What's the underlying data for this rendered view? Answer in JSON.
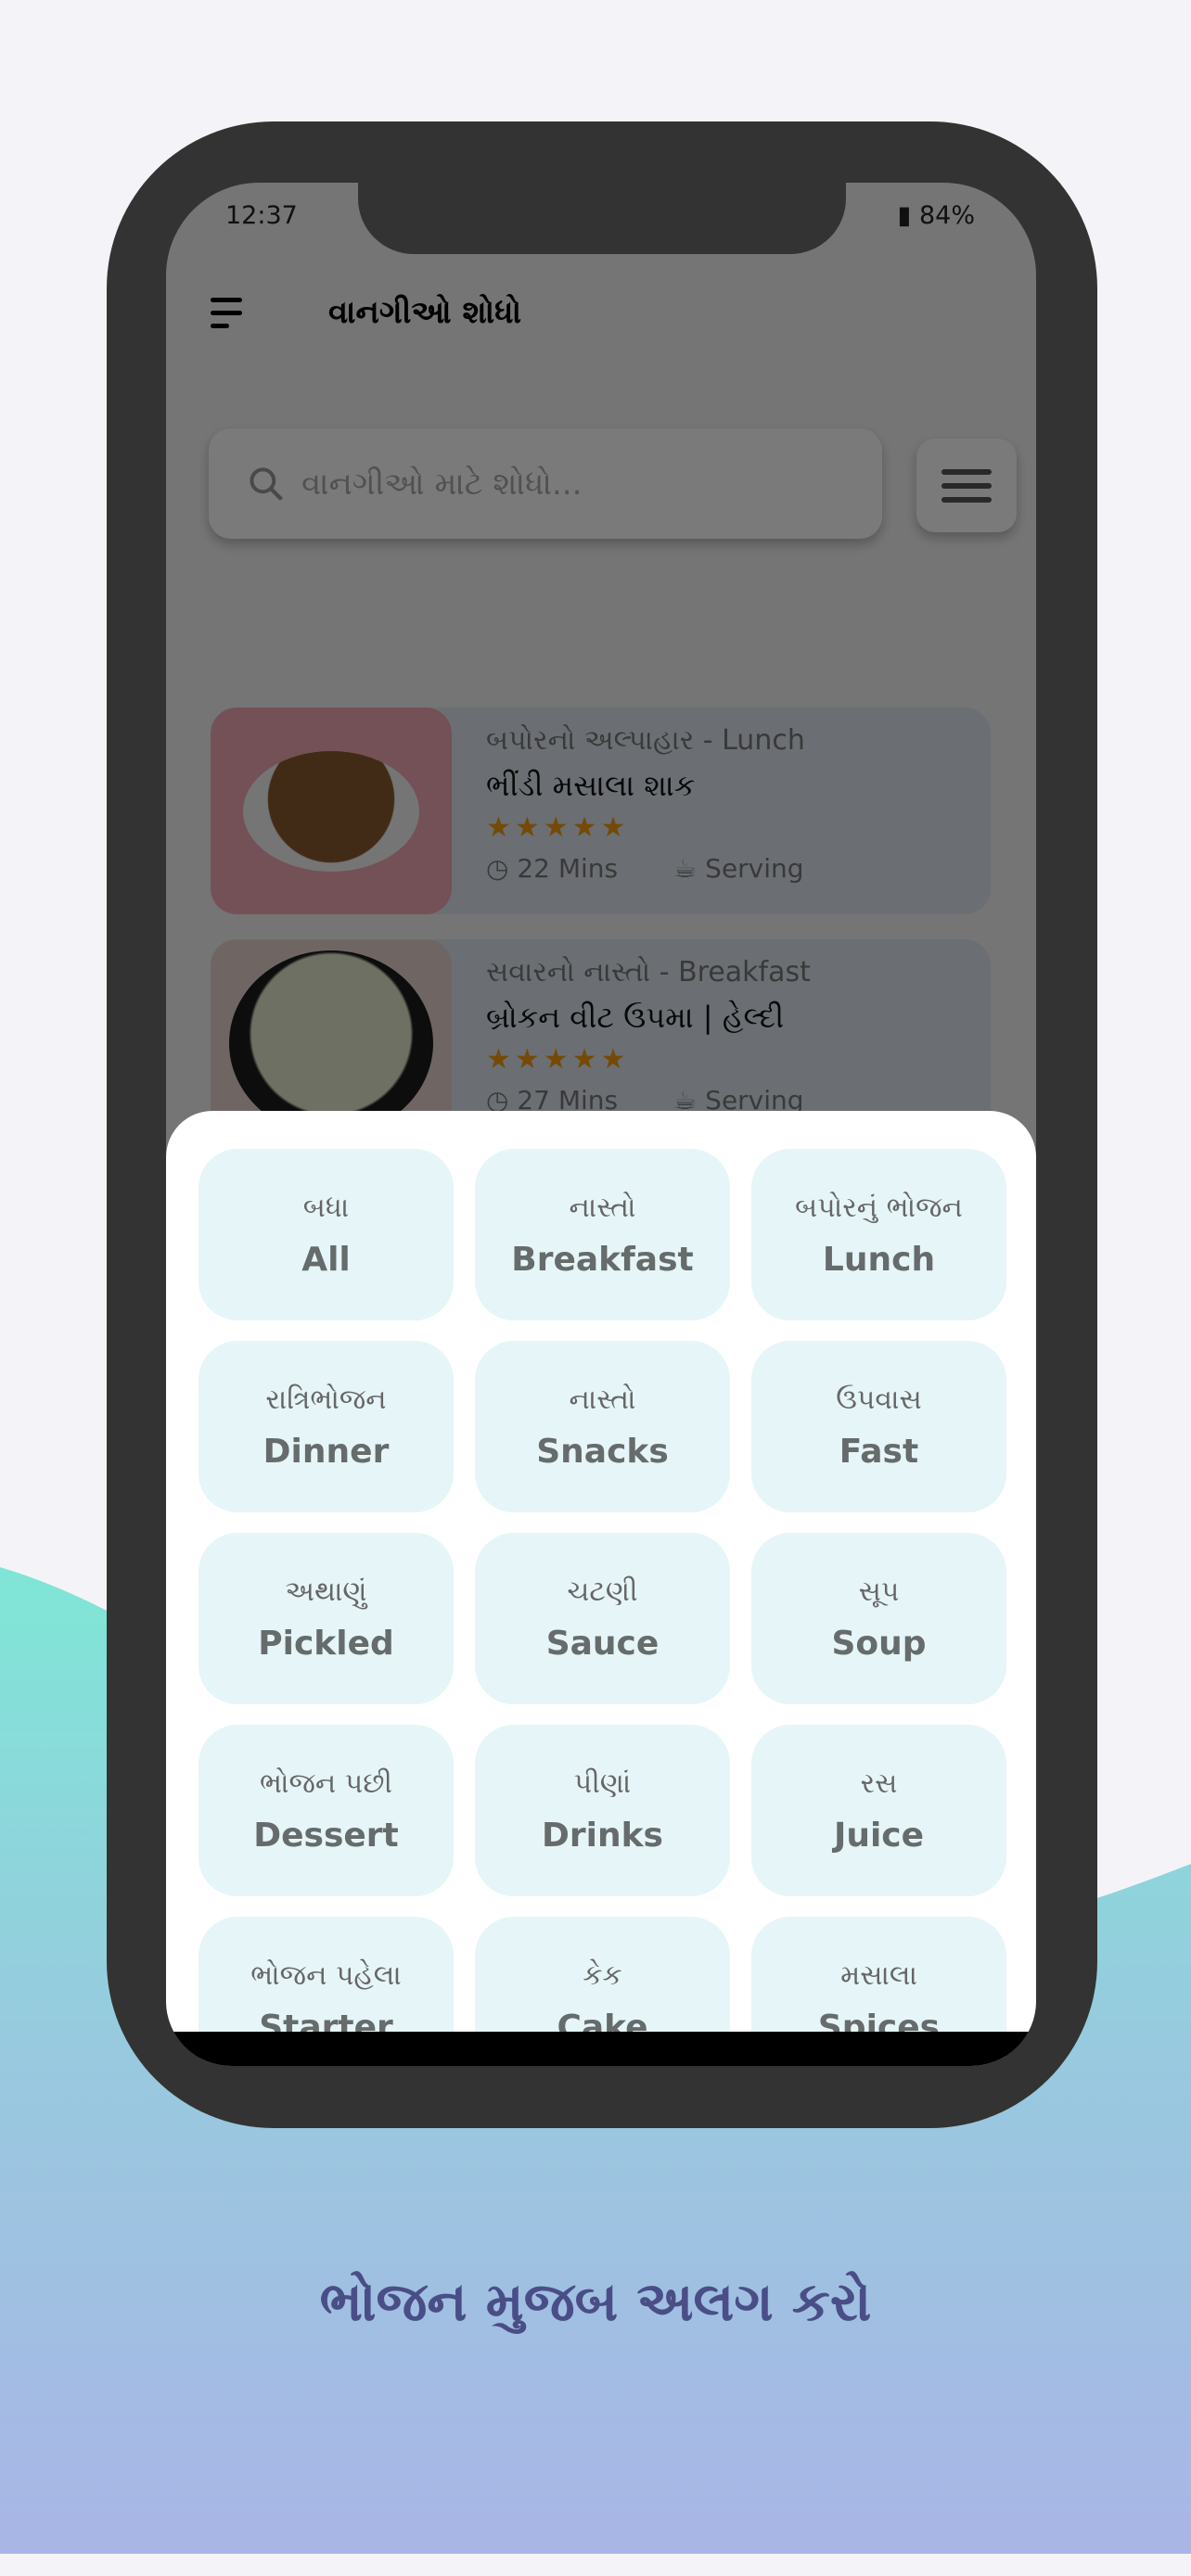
{
  "status_bar": {
    "time": "12:37",
    "battery": "84%"
  },
  "header": {
    "title": "વાનગીઓ શોધો"
  },
  "search": {
    "placeholder": "વાનગીઓ માટે શોધો..."
  },
  "recipes": [
    {
      "category": "બપોરનો અલ્પાહાર - Lunch",
      "name": "ભીંડી મસાલા શાક",
      "rating": 5,
      "stars": "★★★★★",
      "time": "22 Mins",
      "serving": "Serving"
    },
    {
      "category": "સવારનો નાસ્તો - Breakfast",
      "name": "બ્રોકન વીટ ઉપમા | હેલ્દી",
      "rating": 5,
      "stars": "★★★★★",
      "time": "27 Mins",
      "serving": "Serving"
    }
  ],
  "categories": [
    {
      "gu": "બધા",
      "en": "All"
    },
    {
      "gu": "નાસ્તો",
      "en": "Breakfast"
    },
    {
      "gu": "બપોરનું ભોજન",
      "en": "Lunch"
    },
    {
      "gu": "રાત્રિભોજન",
      "en": "Dinner"
    },
    {
      "gu": "નાસ્તો",
      "en": "Snacks"
    },
    {
      "gu": "ઉપવાસ",
      "en": "Fast"
    },
    {
      "gu": "અથાણું",
      "en": "Pickled"
    },
    {
      "gu": "ચટણી",
      "en": "Sauce"
    },
    {
      "gu": "સૂપ",
      "en": "Soup"
    },
    {
      "gu": "ભોજન પછી",
      "en": "Dessert"
    },
    {
      "gu": "પીણાં",
      "en": "Drinks"
    },
    {
      "gu": "રસ",
      "en": "Juice"
    },
    {
      "gu": "ભોજન પહેલા",
      "en": "Starter"
    },
    {
      "gu": "કેક",
      "en": "Cake"
    },
    {
      "gu": "મસાલા",
      "en": "Spices"
    }
  ],
  "caption": "ભોજન મુજબ અલગ કરો",
  "colors": {
    "accent": "#4a4e86",
    "star": "#f29a0c",
    "chip": "#e6f5f8",
    "wave_top": "#7fe6d6",
    "wave_bottom": "#a9b5e6"
  }
}
